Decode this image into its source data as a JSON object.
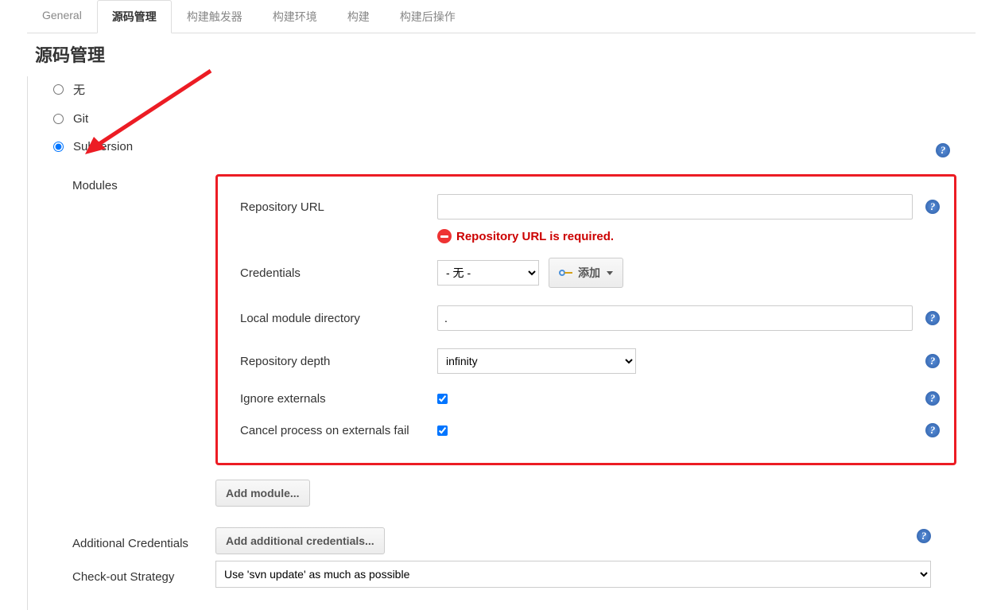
{
  "tabs": [
    "General",
    "源码管理",
    "构建触发器",
    "构建环境",
    "构建",
    "构建后操作"
  ],
  "active_tab_index": 1,
  "section_title": "源码管理",
  "scm": {
    "none_label": "无",
    "git_label": "Git",
    "svn_label": "Subversion",
    "selected": "svn"
  },
  "modules": {
    "label": "Modules",
    "repo_url": {
      "label": "Repository URL",
      "value": "",
      "error": "Repository URL is required."
    },
    "credentials": {
      "label": "Credentials",
      "selected": "- 无 -",
      "add_label": "添加"
    },
    "local_dir": {
      "label": "Local module directory",
      "value": "."
    },
    "depth": {
      "label": "Repository depth",
      "selected": "infinity"
    },
    "ignore_ext": {
      "label": "Ignore externals",
      "checked": true
    },
    "cancel_ext": {
      "label": "Cancel process on externals fail",
      "checked": true
    },
    "add_module_label": "Add module..."
  },
  "additional_credentials": {
    "label": "Additional Credentials",
    "button": "Add additional credentials..."
  },
  "checkout": {
    "label": "Check-out Strategy",
    "selected": "Use 'svn update' as much as possible"
  }
}
